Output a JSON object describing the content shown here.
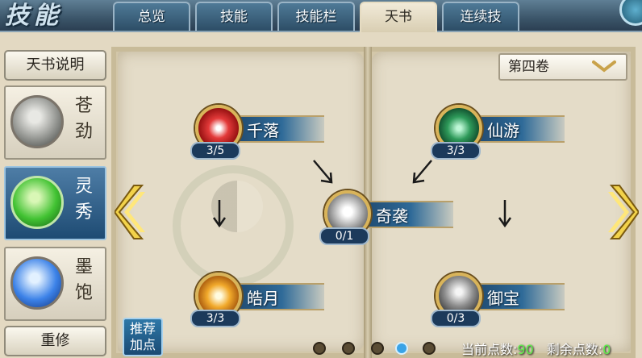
{
  "header": {
    "brand": "技能",
    "tabs": [
      {
        "label": "总览",
        "active": false
      },
      {
        "label": "技能",
        "active": false
      },
      {
        "label": "技能栏",
        "active": false
      },
      {
        "label": "天书",
        "active": true
      },
      {
        "label": "连续技",
        "active": false
      }
    ]
  },
  "sidebar": {
    "info_button": "天书说明",
    "schools": [
      {
        "name": "苍劲",
        "icon": "cangjin-school-icon",
        "active": false
      },
      {
        "name": "灵秀",
        "icon": "lingxiu-school-icon",
        "active": true
      },
      {
        "name": "墨饱",
        "icon": "mobao-school-icon",
        "active": false
      }
    ],
    "reset_button": "重修"
  },
  "book": {
    "volume": "第四卷",
    "skills": {
      "qianluo": {
        "name": "千落",
        "count": "3/5",
        "icon": "qianluo-skill-icon"
      },
      "xianyou": {
        "name": "仙游",
        "count": "3/3",
        "icon": "xianyou-skill-icon"
      },
      "qixi": {
        "name": "奇袭",
        "count": "0/1",
        "icon": "qixi-skill-icon"
      },
      "haoyue": {
        "name": "皓月",
        "count": "3/3",
        "icon": "haoyue-skill-icon"
      },
      "yubao": {
        "name": "御宝",
        "count": "0/3",
        "icon": "yubao-skill-icon"
      }
    }
  },
  "footer": {
    "recommend_line1": "推荐",
    "recommend_line2": "加点",
    "current_points_label": "当前点数:",
    "current_points_value": "90",
    "remaining_points_label": "剩余点数:",
    "remaining_points_value": "0",
    "pages": 5,
    "active_page": 4
  },
  "colors": {
    "accent_blue": "#2e6a98",
    "parchment": "#e4dcc8",
    "gold": "#d9b45a",
    "points_green": "#5ef04a"
  }
}
